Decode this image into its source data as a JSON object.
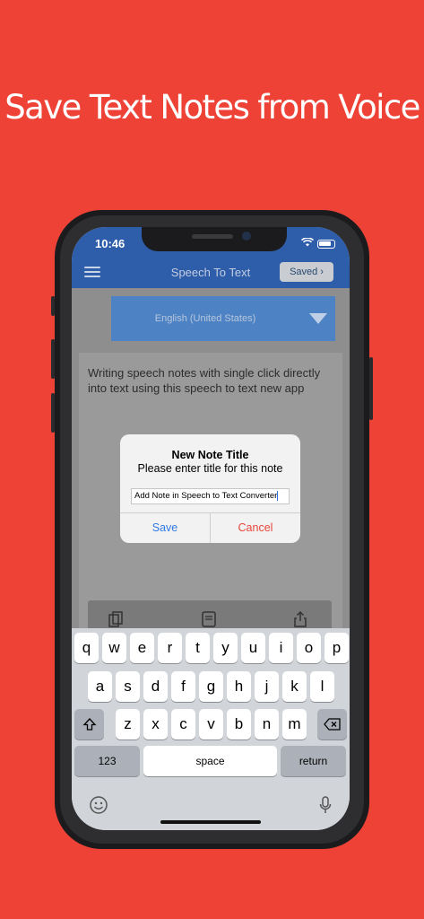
{
  "headline": "Save Text Notes from Voice",
  "status_bar": {
    "time": "10:46"
  },
  "navbar": {
    "title": "Speech To Text",
    "saved_label": "Saved",
    "saved_chevron": "›"
  },
  "language_select": {
    "selected": "English (United States)"
  },
  "note_text": "Writing speech notes with single click directly into text using this speech to text new app",
  "dialog": {
    "title": "New Note Title",
    "message": "Please enter title for this note",
    "input_value": "Add Note in Speech to Text Converter",
    "save_label": "Save",
    "cancel_label": "Cancel"
  },
  "keyboard": {
    "row1": [
      "q",
      "w",
      "e",
      "r",
      "t",
      "y",
      "u",
      "i",
      "o",
      "p"
    ],
    "row2": [
      "a",
      "s",
      "d",
      "f",
      "g",
      "h",
      "j",
      "k",
      "l"
    ],
    "row3": [
      "z",
      "x",
      "c",
      "v",
      "b",
      "n",
      "m"
    ],
    "numbers_label": "123",
    "space_label": "space",
    "return_label": "return"
  },
  "colors": {
    "background": "#ee4237",
    "navbar": "#2e5daa",
    "save": "#2f7ae5",
    "cancel": "#e8463b"
  }
}
